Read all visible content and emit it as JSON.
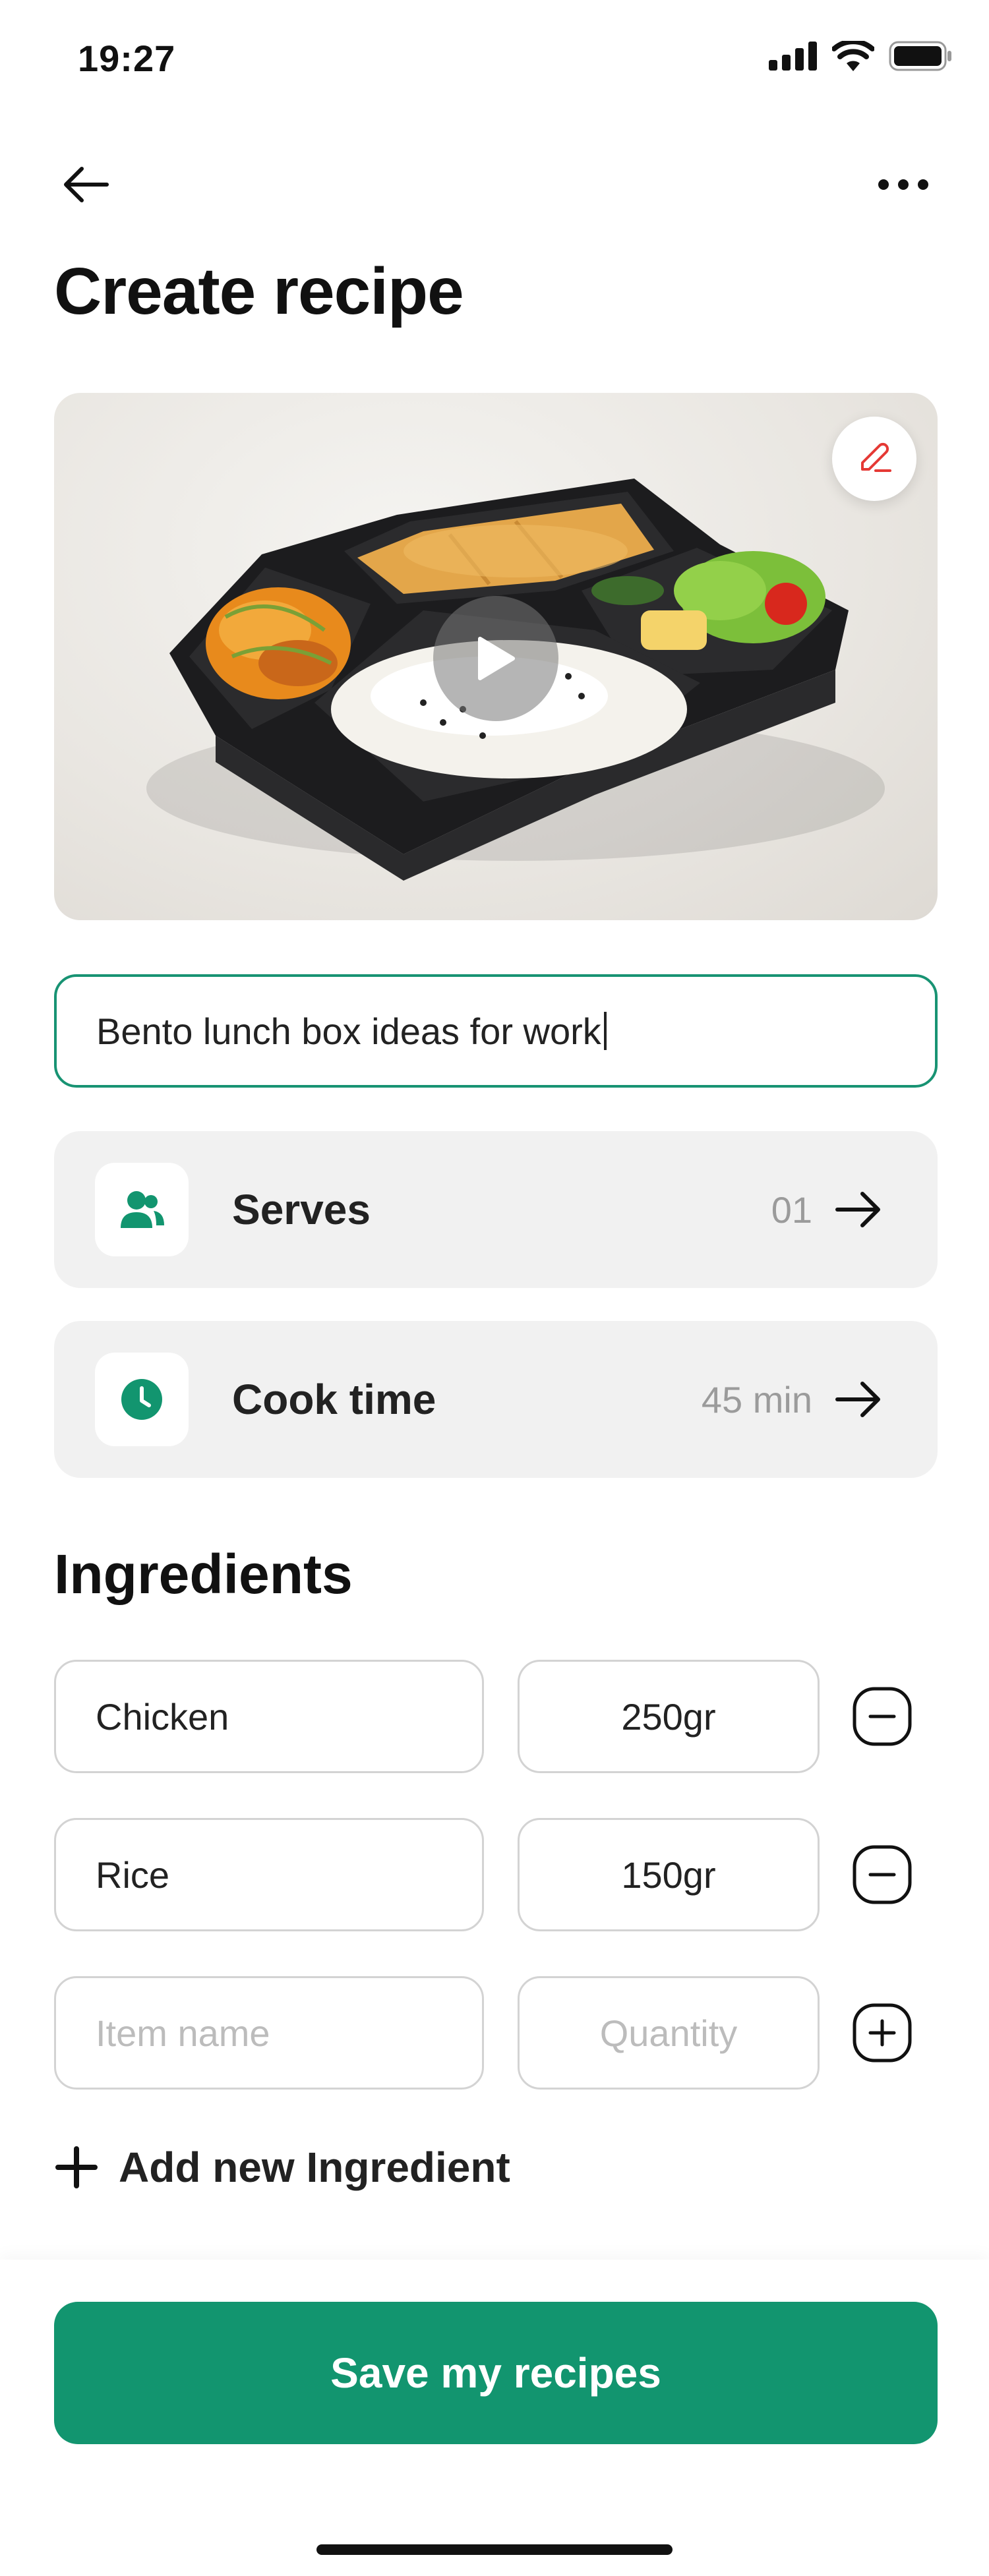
{
  "status": {
    "time": "19:27"
  },
  "header": {
    "title": "Create recipe"
  },
  "recipe": {
    "name": "Bento lunch box ideas for work"
  },
  "options": [
    {
      "label": "Serves",
      "value": "01",
      "icon": "people-icon"
    },
    {
      "label": "Cook time",
      "value": "45 min",
      "icon": "clock-icon"
    }
  ],
  "ingredients": {
    "title": "Ingredients",
    "items": [
      {
        "name": "Chicken",
        "quantity": "250gr"
      },
      {
        "name": "Rice",
        "quantity": "150gr"
      }
    ],
    "new_item": {
      "name_placeholder": "Item name",
      "quantity_placeholder": "Quantity"
    },
    "add_label": "Add new Ingredient"
  },
  "actions": {
    "save_label": "Save my recipes"
  },
  "colors": {
    "accent": "#12956f",
    "input_border": "#189373",
    "edit_icon": "#e53935"
  }
}
